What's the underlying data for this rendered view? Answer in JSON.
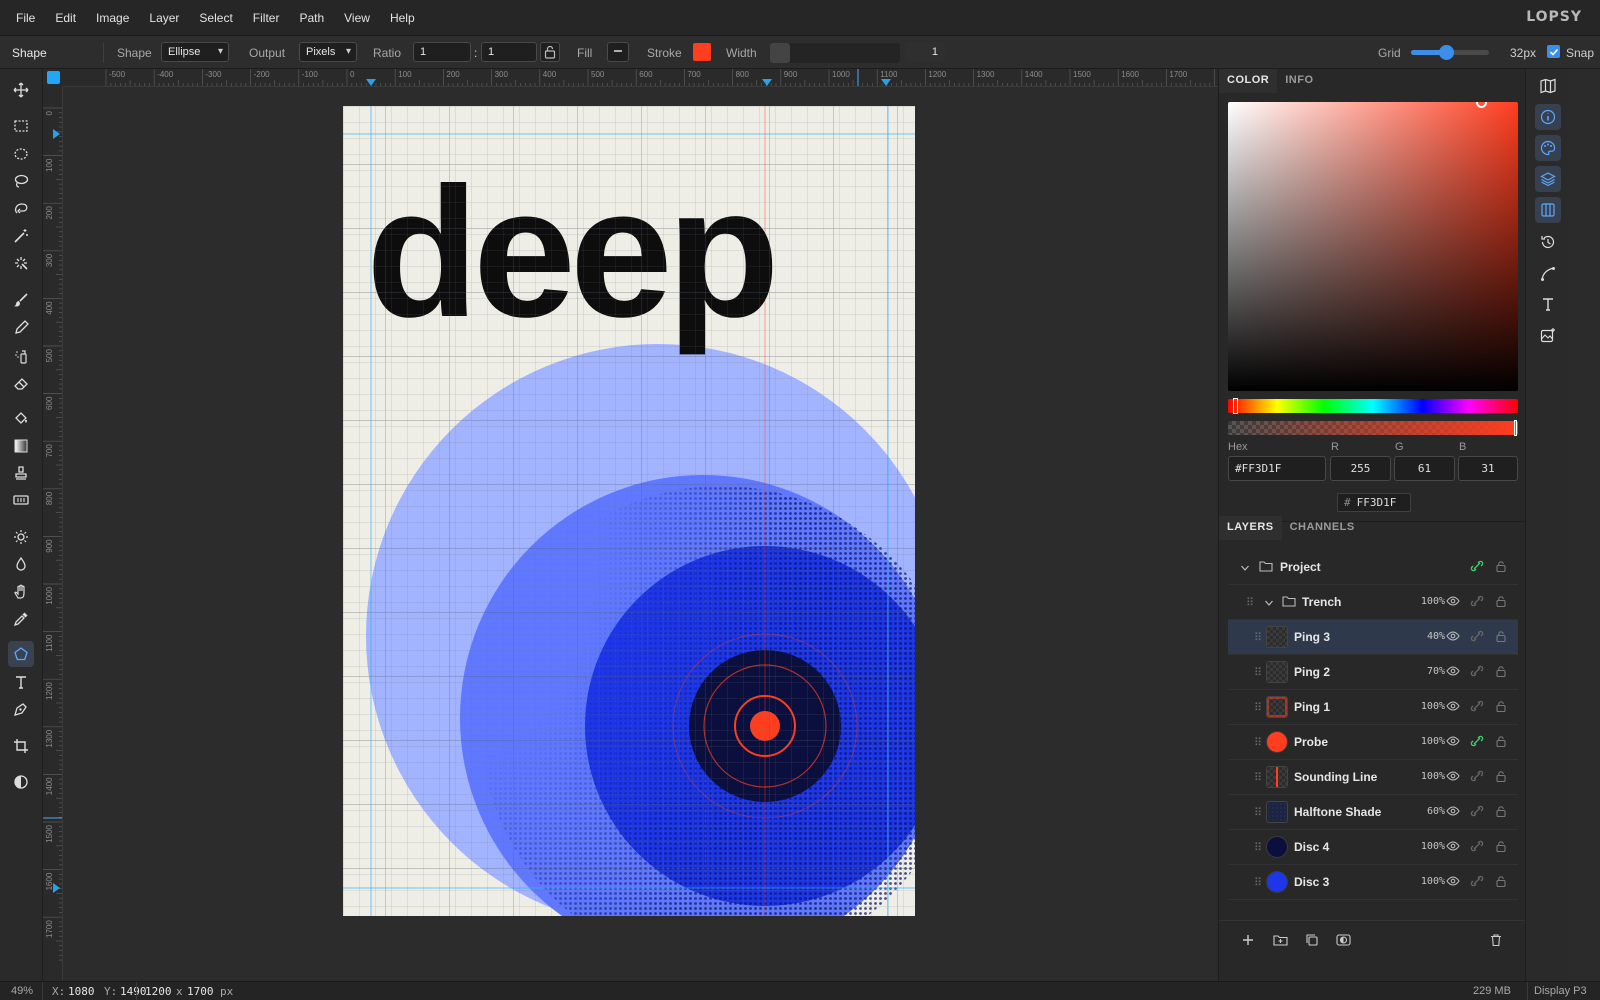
{
  "menu": {
    "items": [
      "File",
      "Edit",
      "Image",
      "Layer",
      "Select",
      "Filter",
      "Path",
      "View",
      "Help"
    ],
    "brand": "LOPSY"
  },
  "options": {
    "tool_name": "Shape",
    "shape_label": "Shape",
    "shape_value": "Ellipse",
    "output_label": "Output",
    "output_value": "Pixels",
    "ratio_label": "Ratio",
    "ratio_a": "1",
    "ratio_sep": ":",
    "ratio_b": "1",
    "fill_label": "Fill",
    "stroke_label": "Stroke",
    "stroke_color": "#ff3d1f",
    "width_label": "Width",
    "width_value": "1",
    "grid_label": "Grid",
    "grid_slider_fraction": 0.45,
    "grid_value": "32px",
    "snap_label": "Snap",
    "snap_checked": true
  },
  "tools": [
    "move-icon",
    "rect-select-icon",
    "ellipse-select-icon",
    "lasso-icon",
    "magnetic-lasso-icon",
    "magic-wand-icon",
    "quick-select-icon",
    "brush-icon",
    "pencil-icon",
    "spray-icon",
    "eraser-icon",
    "fill-bucket-icon",
    "gradient-icon",
    "stamp-icon",
    "patch-icon",
    "dodge-icon",
    "blur-icon",
    "hand-icon",
    "eyedropper-icon",
    "shape-icon",
    "text-icon",
    "pen-icon",
    "crop-icon",
    "contrast-icon"
  ],
  "active_tool": "shape-icon",
  "ruler": {
    "top_labels": [
      "-500",
      "-400",
      "-300",
      "-200",
      "-100",
      "0",
      "100",
      "200",
      "300",
      "400",
      "500",
      "600",
      "700",
      "800",
      "900",
      "1000",
      "1100",
      "1200",
      "1300",
      "1400",
      "1500",
      "1600",
      "1700",
      "180"
    ],
    "left_labels": [
      "0",
      "100",
      "200",
      "300",
      "400",
      "500",
      "600",
      "700",
      "800",
      "900",
      "1000",
      "1100",
      "1200",
      "1300",
      "1400",
      "1500",
      "1600",
      "1700"
    ]
  },
  "artwork": {
    "word": "deep",
    "paper_color": "#efeee6",
    "accent": "#ff3d1f"
  },
  "color_panel": {
    "tabs": [
      "COLOR",
      "INFO"
    ],
    "active_tab": "COLOR",
    "hex_label": "Hex",
    "hex_value": "#FF3D1F",
    "r_label": "R",
    "r_value": "255",
    "g_label": "G",
    "g_value": "61",
    "b_label": "B",
    "b_value": "31",
    "chip_hash": "#",
    "chip_value": "FF3D1F",
    "current_color": "#ff3d1f"
  },
  "layers_panel": {
    "tabs": [
      "LAYERS",
      "CHANNELS"
    ],
    "active_tab": "LAYERS",
    "project": "Project",
    "group": "Trench",
    "group_opacity": "100%",
    "layers": [
      {
        "name": "Ping 3",
        "opacity": "40%",
        "selected": true,
        "thumb": "checker"
      },
      {
        "name": "Ping 2",
        "opacity": "70%",
        "selected": false,
        "thumb": "checker"
      },
      {
        "name": "Ping 1",
        "opacity": "100%",
        "selected": false,
        "thumb": "ring"
      },
      {
        "name": "Probe",
        "opacity": "100%",
        "selected": false,
        "thumb": "#ff3d1f"
      },
      {
        "name": "Sounding Line",
        "opacity": "100%",
        "selected": false,
        "thumb": "line"
      },
      {
        "name": "Halftone Shade",
        "opacity": "60%",
        "selected": false,
        "thumb": "halftone"
      },
      {
        "name": "Disc 4",
        "opacity": "100%",
        "selected": false,
        "thumb": "#0a0f3d"
      },
      {
        "name": "Disc 3",
        "opacity": "100%",
        "selected": false,
        "thumb": "#1d36e8"
      }
    ]
  },
  "status": {
    "zoom": "49%",
    "x_label": "X:",
    "x_value": "1080",
    "y_label": "Y:",
    "y_value": "1490",
    "doc_w": "1200",
    "doc_x": "x",
    "doc_h": "1700",
    "doc_unit": "px",
    "memory": "229 MB",
    "profile": "Display P3"
  }
}
